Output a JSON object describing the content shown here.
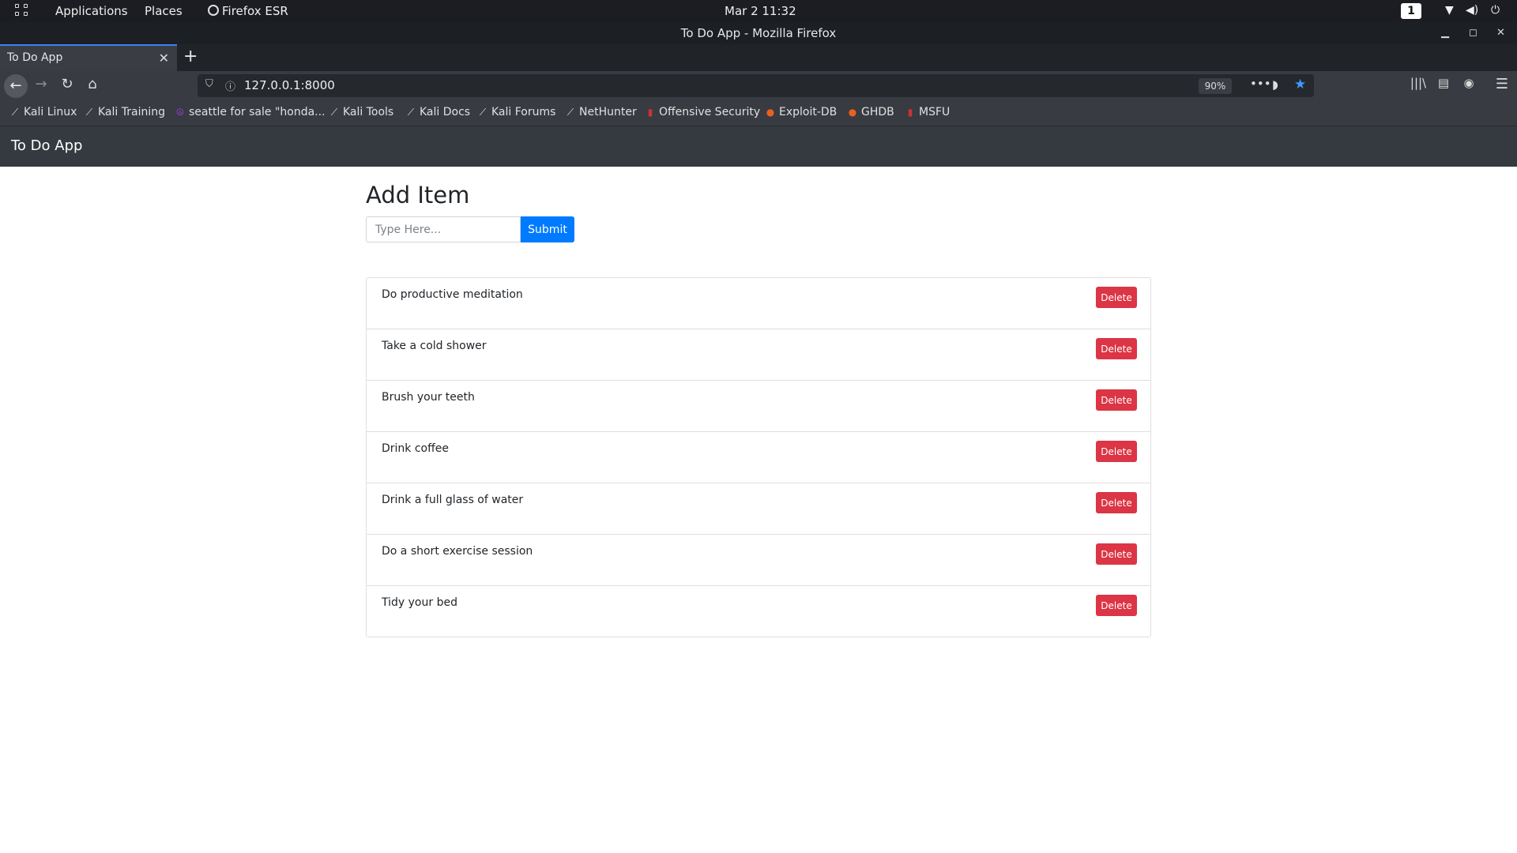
{
  "topbar": {
    "applications": "Applications",
    "places": "Places",
    "browser": "Firefox ESR",
    "clock": "Mar 2  11:32",
    "workspace": "1"
  },
  "window": {
    "title": "To Do App - Mozilla Firefox"
  },
  "tabs": [
    {
      "label": "To Do App"
    }
  ],
  "toolbar": {
    "url": "127.0.0.1:8000",
    "zoom": "90%"
  },
  "bookmarks": [
    {
      "label": "Kali Linux",
      "icon": "kali-dragon-icon"
    },
    {
      "label": "Kali Training",
      "icon": "kali-dragon-icon"
    },
    {
      "label": "seattle for sale \"honda...",
      "icon": "peace-icon"
    },
    {
      "label": "Kali Tools",
      "icon": "kali-dragon-icon"
    },
    {
      "label": "Kali Docs",
      "icon": "kali-dragon-icon"
    },
    {
      "label": "Kali Forums",
      "icon": "kali-dragon-icon"
    },
    {
      "label": "NetHunter",
      "icon": "kali-dragon-icon"
    },
    {
      "label": "Offensive Security",
      "icon": "offsec-icon"
    },
    {
      "label": "Exploit-DB",
      "icon": "exploit-db-icon"
    },
    {
      "label": "GHDB",
      "icon": "exploit-db-icon"
    },
    {
      "label": "MSFU",
      "icon": "offsec-icon"
    }
  ],
  "app": {
    "brand": "To Do App",
    "heading": "Add Item",
    "input_placeholder": "Type Here...",
    "submit_label": "Submit",
    "delete_label": "Delete",
    "items": [
      "Do productive meditation",
      "Take a cold shower",
      "Brush your teeth",
      "Drink coffee",
      "Drink a full glass of water",
      "Do a short exercise session",
      "Tidy your bed"
    ]
  },
  "colors": {
    "primary": "#007bff",
    "danger": "#dc3545",
    "navbar": "#343a40"
  }
}
